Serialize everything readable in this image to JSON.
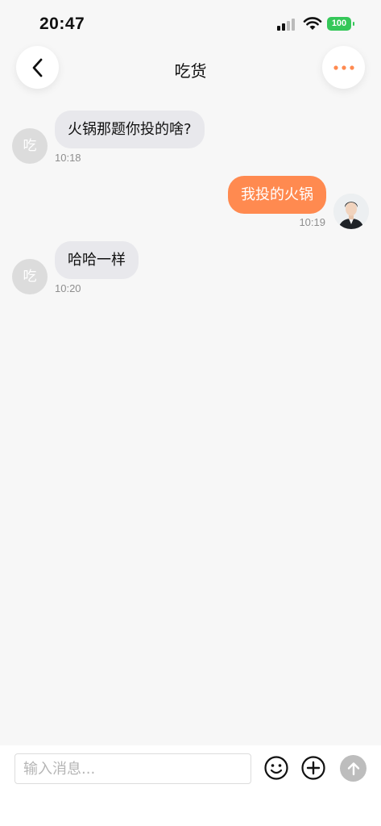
{
  "status_bar": {
    "time": "20:47",
    "battery": "100",
    "battery_color": "#35c759"
  },
  "header": {
    "title": "吃货",
    "back_icon": "chevron-left-icon",
    "more_icon": "ellipsis-icon",
    "accent_color": "#ff8a50"
  },
  "messages": [
    {
      "direction": "incoming",
      "avatar_text": "吃",
      "text": "火锅那题你投的啥?",
      "time": "10:18"
    },
    {
      "direction": "outgoing",
      "avatar": "user-photo",
      "text": "我投的火锅",
      "time": "10:19"
    },
    {
      "direction": "incoming",
      "avatar_text": "吃",
      "text": "哈哈一样",
      "time": "10:20"
    }
  ],
  "input_bar": {
    "placeholder": "输入消息...",
    "emoji_icon": "smiley-icon",
    "plus_icon": "plus-circle-icon",
    "send_icon": "arrow-up-icon"
  }
}
